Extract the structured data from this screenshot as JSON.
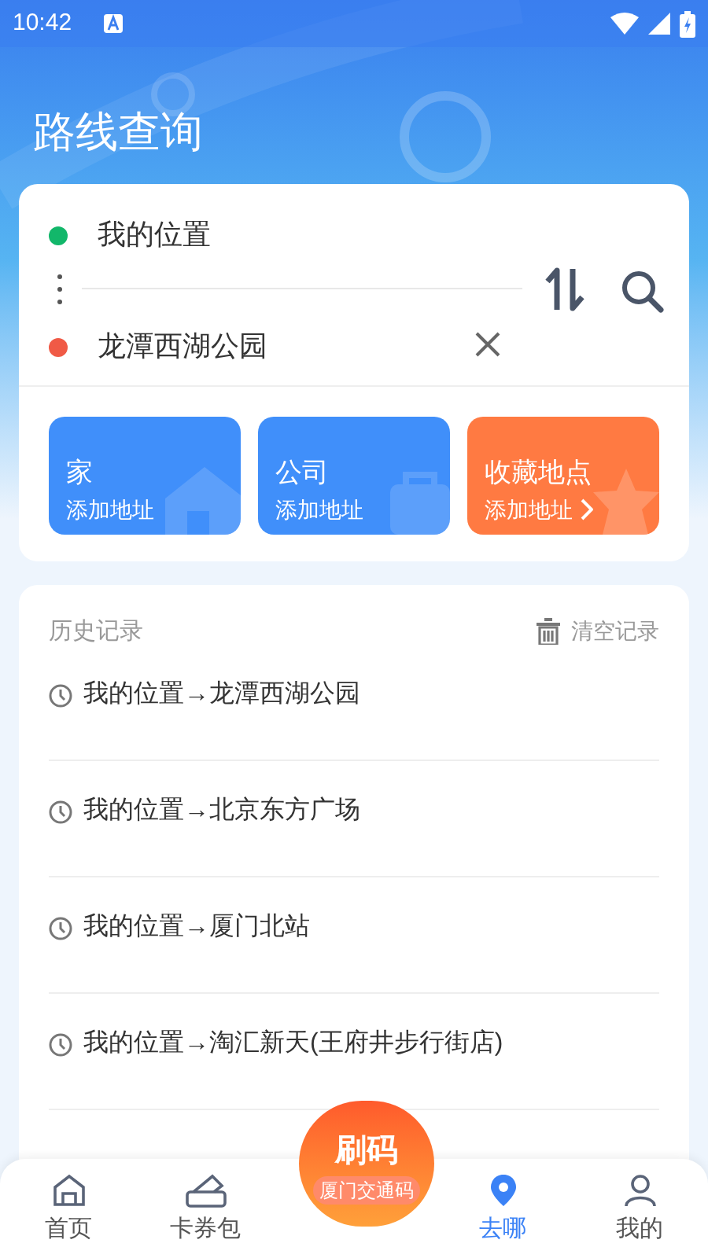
{
  "status_bar": {
    "time": "10:42"
  },
  "title": "路线查询",
  "route": {
    "origin": "我的位置",
    "destination": "龙潭西湖公园"
  },
  "shortcuts": [
    {
      "kind": "home",
      "title": "家",
      "subtitle": "添加地址"
    },
    {
      "kind": "work",
      "title": "公司",
      "subtitle": "添加地址"
    },
    {
      "kind": "favorite",
      "title": "收藏地点",
      "subtitle": "添加地址"
    }
  ],
  "history": {
    "title": "历史记录",
    "clear": "清空记录",
    "items": [
      "我的位置→龙潭西湖公园",
      "我的位置→北京东方广场",
      "我的位置→厦门北站",
      "我的位置→淘汇新天(王府井步行街店)"
    ]
  },
  "bottom_nav": {
    "center": {
      "title": "刷码",
      "subtitle": "厦门交通码"
    },
    "tabs": [
      {
        "kind": "home",
        "label": "首页",
        "selected": false
      },
      {
        "kind": "card",
        "label": "卡券包",
        "selected": false
      },
      {
        "kind": "go",
        "label": "去哪",
        "selected": true
      },
      {
        "kind": "me",
        "label": "我的",
        "selected": false
      }
    ]
  }
}
